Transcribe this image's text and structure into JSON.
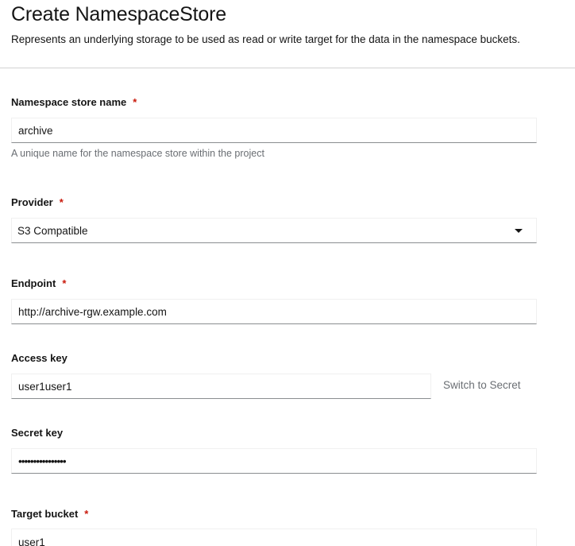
{
  "header": {
    "title": "Create NamespaceStore",
    "description": "Represents an underlying storage to be used as read or write target for the data in the namespace buckets."
  },
  "form": {
    "name": {
      "label": "Namespace store name",
      "required_mark": "*",
      "value": "archive",
      "helper": "A unique name for the namespace store within the project"
    },
    "provider": {
      "label": "Provider",
      "required_mark": "*",
      "selected": "S3 Compatible"
    },
    "endpoint": {
      "label": "Endpoint",
      "required_mark": "*",
      "value": "http://archive-rgw.example.com"
    },
    "access_key": {
      "label": "Access key",
      "value": "user1user1",
      "switch_label": "Switch to Secret"
    },
    "secret_key": {
      "label": "Secret key",
      "value": "••••••••••••••••"
    },
    "target_bucket": {
      "label": "Target bucket",
      "required_mark": "*",
      "value": "user1"
    }
  }
}
